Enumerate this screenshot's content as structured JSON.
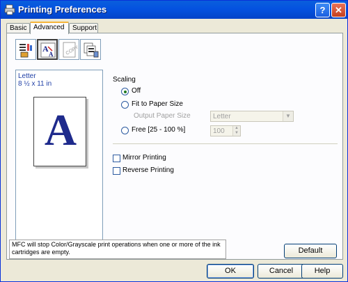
{
  "window": {
    "title": "Printing Preferences",
    "help_glyph": "?",
    "close_glyph": "✕"
  },
  "tabs": [
    {
      "label": "Basic"
    },
    {
      "label": "Advanced",
      "active": true
    },
    {
      "label": "Support"
    }
  ],
  "toolbar": {
    "icons": [
      "print-quality-icon",
      "scaling-icon",
      "copy-watermark-icon",
      "device-options-icon"
    ],
    "selected_index": 1
  },
  "preview": {
    "paper_name": "Letter",
    "paper_size": "8 ½ x 11 in",
    "sample_letter": "A"
  },
  "scaling": {
    "heading": "Scaling",
    "selected": "Off",
    "off_label": "Off",
    "fit_label": "Fit to Paper Size",
    "output_paper_size_label": "Output Paper Size",
    "output_paper_size_value": "Letter",
    "free_label": "Free [25 - 100 %]",
    "free_value": "100"
  },
  "options": {
    "mirror_label": "Mirror Printing",
    "mirror_checked": false,
    "reverse_label": "Reverse Printing",
    "reverse_checked": false
  },
  "message": "MFC will stop Color/Grayscale print operations when one or more of the ink cartridges are empty.",
  "buttons": {
    "default_label": "Default",
    "ok_label": "OK",
    "cancel_label": "Cancel",
    "help_label": "Help"
  },
  "colors": {
    "title_bar": "#0452e0",
    "panel_bg": "#fcfcfe",
    "dialog_bg": "#ece9d8",
    "preview_text": "#1f3fa6"
  }
}
